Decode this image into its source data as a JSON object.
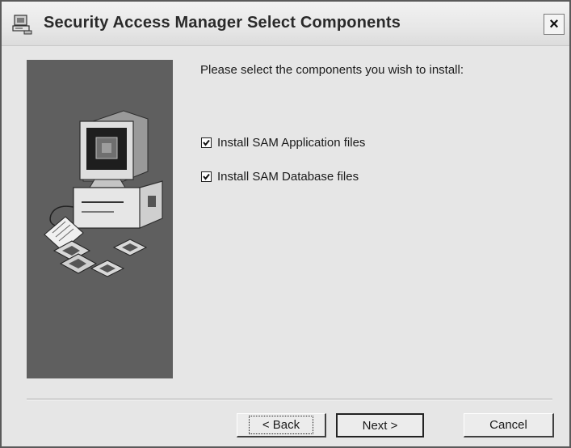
{
  "window": {
    "title": "Security Access Manager Select Components",
    "icon": "setup-computer-icon",
    "close_label": "×"
  },
  "main": {
    "instruction": "Please select the components you wish to install:",
    "components": [
      {
        "label": "Install SAM Application files",
        "checked": true
      },
      {
        "label": "Install SAM Database files",
        "checked": true
      }
    ]
  },
  "side_panel": {
    "illustration": "computer-with-disks-illustration"
  },
  "footer": {
    "back_label": "< Back",
    "next_label": "Next >",
    "cancel_label": "Cancel"
  }
}
